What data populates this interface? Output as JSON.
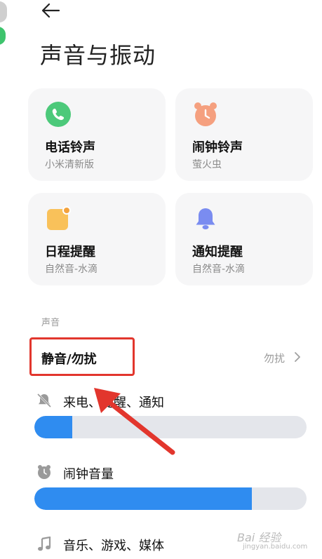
{
  "header": {
    "title": "声音与振动"
  },
  "cards": [
    {
      "name": "电话铃声",
      "sub": "小米清新版",
      "icon": "phone-icon",
      "color": "#4cc97a"
    },
    {
      "name": "闹钟铃声",
      "sub": "萤火虫",
      "icon": "alarm-clock-icon",
      "color": "#f5a07f"
    },
    {
      "name": "日程提醒",
      "sub": "自然音-水滴",
      "icon": "calendar-icon",
      "color": "#f9c15a"
    },
    {
      "name": "通知提醒",
      "sub": "自然音-水滴",
      "icon": "bell-icon",
      "color": "#7a8cf0"
    }
  ],
  "section": {
    "label": "声音"
  },
  "mute": {
    "label": "静音/勿扰",
    "value": "勿扰"
  },
  "volumes": [
    {
      "label": "来电、提醒、通知",
      "icon": "bell-mute-icon",
      "level": 0.14
    },
    {
      "label": "闹钟音量",
      "icon": "alarm-clock-icon",
      "level": 0.8
    },
    {
      "label": "音乐、游戏、媒体",
      "icon": "music-icon"
    }
  ],
  "colors": {
    "accent": "#2f8cf0",
    "highlight": "#e2362d"
  },
  "watermark": {
    "text": "Bai 经验",
    "sub": "jingyan.baidu.com"
  }
}
